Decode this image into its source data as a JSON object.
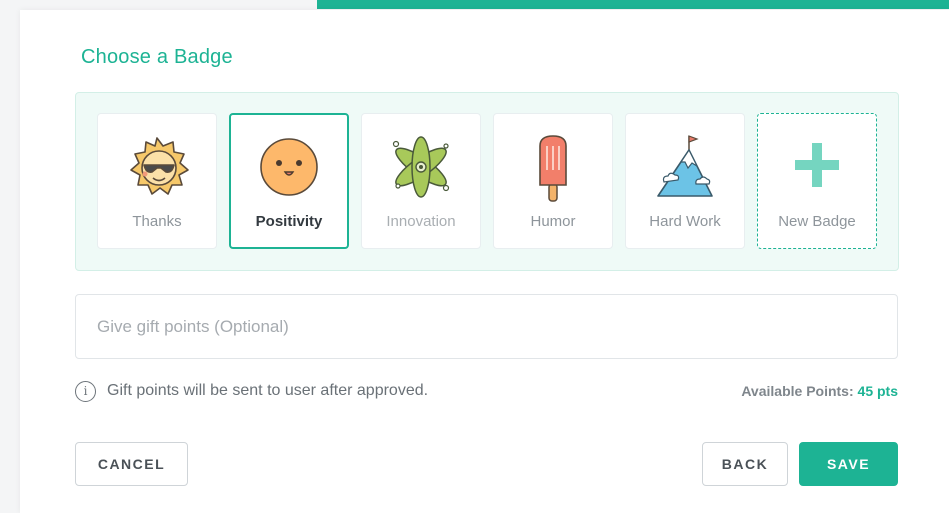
{
  "accent_color": "#1db394",
  "title": "Choose a Badge",
  "badges": [
    {
      "label": "Thanks",
      "icon": "sun-sunglasses-icon"
    },
    {
      "label": "Positivity",
      "icon": "smiley-face-icon"
    },
    {
      "label": "Innovation",
      "icon": "atom-icon"
    },
    {
      "label": "Humor",
      "icon": "popsicle-icon"
    },
    {
      "label": "Hard Work",
      "icon": "mountain-flag-icon"
    },
    {
      "label": "New Badge",
      "icon": "plus-icon"
    }
  ],
  "selected_badge": "Positivity",
  "gift_points": {
    "placeholder": "Give gift points (Optional)",
    "value": ""
  },
  "info_text": "Gift points will be sent to user after approved.",
  "available": {
    "label": "Available Points:",
    "value": "45 pts"
  },
  "buttons": {
    "cancel": "CANCEL",
    "back": "BACK",
    "save": "SAVE"
  }
}
